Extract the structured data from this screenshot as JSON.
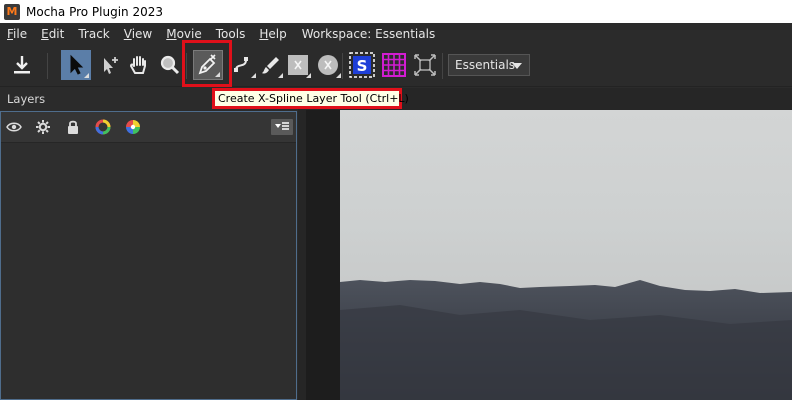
{
  "window": {
    "title": "Mocha Pro Plugin 2023",
    "logo_letter": "M"
  },
  "menu": {
    "items": [
      {
        "label": "File",
        "ul": "F",
        "rest": "ile"
      },
      {
        "label": "Edit",
        "ul": "E",
        "rest": "dit"
      },
      {
        "label": "Track",
        "ul": "",
        "rest": "Track"
      },
      {
        "label": "View",
        "ul": "V",
        "rest": "iew"
      },
      {
        "label": "Movie",
        "ul": "M",
        "rest": "ovie"
      },
      {
        "label": "Tools",
        "ul": "",
        "rest": "Tools"
      },
      {
        "label": "Help",
        "ul": "H",
        "rest": "elp"
      }
    ],
    "workspace_label": "Workspace: Essentials"
  },
  "toolbar": {
    "workspace_dropdown": "Essentials",
    "tooltip": "Create X-Spline Layer Tool (Ctrl+L)"
  },
  "layers": {
    "title": "Layers"
  },
  "colors": {
    "highlight": "#e0101a",
    "select_active": "#5b7ea8",
    "panel_border": "#4f6d8c"
  }
}
